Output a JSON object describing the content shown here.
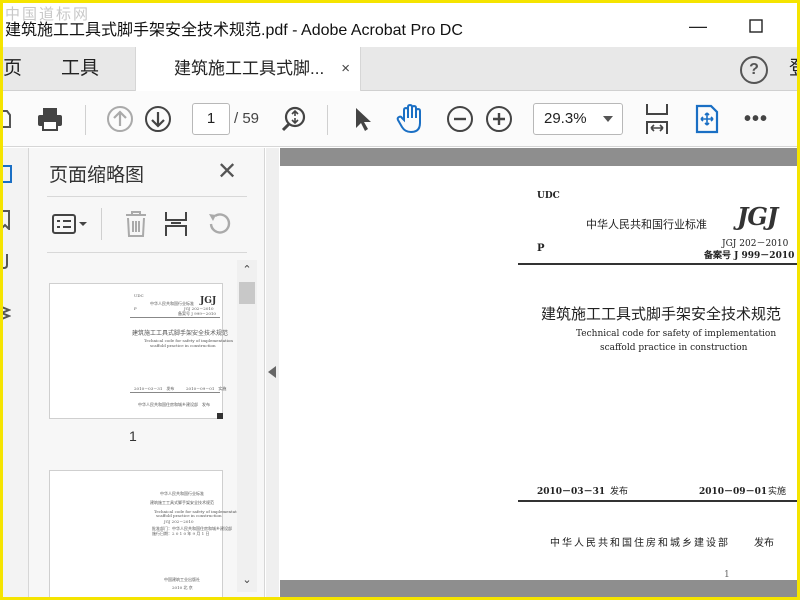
{
  "window": {
    "watermark": "中国道标网",
    "title": "建筑施工工具式脚手架安全技术规范.pdf - Adobe Acrobat Pro DC",
    "minimize_symbol": "—",
    "maximize_symbol": "☐"
  },
  "tabs": {
    "home_label": "主页",
    "tools_label": "工具",
    "doc_label": "建筑施工工具式脚...",
    "close_symbol": "×",
    "help_symbol": "?",
    "login_label": "登录"
  },
  "toolbar": {
    "current_page": "1",
    "total_pages": "/ 59",
    "zoom": "29.3%",
    "more": "•••",
    "icons": [
      "print-icon",
      "prev-page-icon",
      "next-page-icon",
      "find-icon",
      "select-arrow-icon",
      "hand-icon",
      "zoom-out-icon",
      "zoom-in-icon",
      "fit-page-icon",
      "scroll-mode-icon"
    ]
  },
  "panel": {
    "title": "页面缩略图",
    "close_symbol": "✕",
    "thumbnails": [
      {
        "number": "1"
      }
    ]
  },
  "document": {
    "udc": "UDC",
    "standard_category": "中华人民共和国行业标准",
    "logo": "JGJ",
    "code": "JGJ 202－2010",
    "record_no": "备案号 J 999－2010",
    "p_label": "P",
    "title_cn": "建筑施工工具式脚手架安全技术规范",
    "title_en_1": "Technical code for safety of implementation",
    "title_en_2": "scaffold practice in construction",
    "issue_date": "2010－03－31",
    "issue_label": "发布",
    "effective_date": "2010－09－01",
    "effective_label": "实施",
    "publisher": "中华人民共和国住房和城乡建设部",
    "publish_label": "发布",
    "page_number": "1"
  },
  "thumbnail_text": {
    "udc": "UDC",
    "category": "中华人民共和国行业标准",
    "logo": "JGJ",
    "code": "JGJ 202－2010",
    "record": "备案号 J 999－2010",
    "p": "P",
    "title": "建筑施工工具式脚手架安全技术规范",
    "en1": "Technical code for safety of implementation",
    "en2": "scaffold practice in construction",
    "d1": "2010－03－31　发布",
    "d2": "2010－09－01　实施",
    "pub": "中华人民共和国住房和城乡建设部　发布",
    "t2_l1": "中华人民共和国行业标准",
    "t2_l2": "建筑施工工具式脚手架安全技术规范",
    "t2_l3": "Technical code for safety of implementation",
    "t2_l4": "scaffold practice in construction",
    "t2_l5": "JGJ 202－2010",
    "t2_l6": "批准部门：中华人民共和国住房和城乡建设部",
    "t2_l7": "施行日期：2 0 1 0 年 9 月 1 日",
    "t2_l8": "中国建筑工业出版社",
    "t2_l9": "2010 北 京"
  }
}
